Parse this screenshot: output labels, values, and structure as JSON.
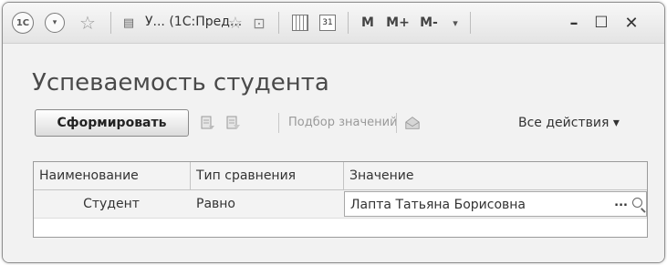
{
  "window": {
    "title": "У... (1С:Пред...",
    "logo_text": "1С",
    "toolbar_m": "M",
    "toolbar_mplus": "M+",
    "toolbar_mminus": "M-",
    "calendar_day": "31",
    "close_glyph": "✕",
    "maximize_glyph": "☐",
    "minimize_glyph": "–"
  },
  "form": {
    "heading": "Успеваемость студента",
    "generate_button": "Сформировать",
    "select_values": "Подбор значений",
    "all_actions": "Все действия ▾"
  },
  "grid": {
    "columns": [
      "Наименование",
      "Тип сравнения",
      "Значение"
    ],
    "rows": [
      {
        "name": "Студент",
        "comparison": "Равно",
        "value": "Лапта Татьяна Борисовна"
      }
    ],
    "value_button": "..."
  }
}
